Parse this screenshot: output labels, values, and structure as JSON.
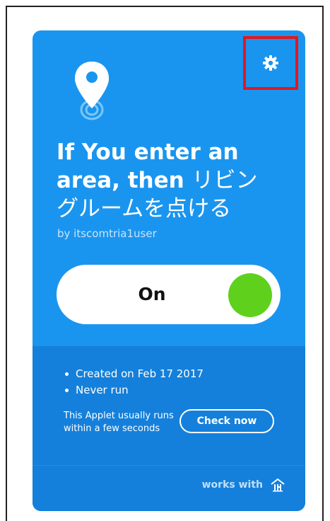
{
  "applet": {
    "title_line1": "If You enter an",
    "title_line2_latin": "area, then",
    "title_line2_jp": "リビン",
    "title_line3": "グルームを点ける",
    "author": "by itscomtria1user"
  },
  "toggle": {
    "label": "On",
    "state": "on",
    "knob_color": "#5fd11d"
  },
  "info": {
    "created": "Created on Feb 17 2017",
    "runs": "Never run",
    "usually": "This Applet usually runs within a few seconds",
    "check_now": "Check now"
  },
  "footer": {
    "works_with": "works with"
  },
  "icons": {
    "settings": "gear-icon",
    "location": "location-pin-icon",
    "service": "ifttt-home-icon"
  },
  "colors": {
    "card": "#1a95ef",
    "card_lower": "#1480db",
    "highlight_box": "#e4171c"
  }
}
